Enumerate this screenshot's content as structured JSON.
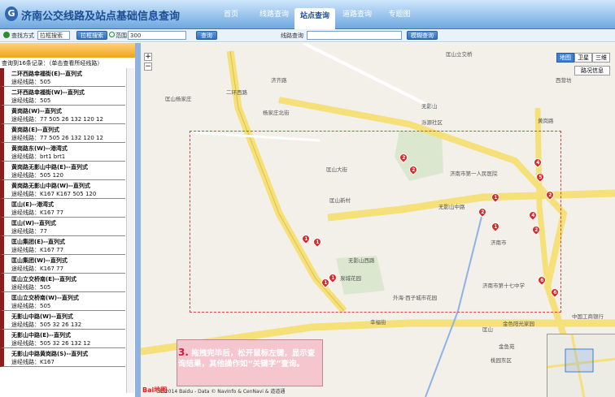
{
  "app": {
    "title": "济南公交线路及站点基础信息查询",
    "logo": "G"
  },
  "nav": {
    "items": [
      {
        "label": "首页",
        "active": false
      },
      {
        "label": "线路查询",
        "active": false
      },
      {
        "label": "站点查询",
        "active": true
      },
      {
        "label": "道路查询",
        "active": false
      },
      {
        "label": "专题图",
        "active": false
      }
    ]
  },
  "toolbar": {
    "mode_label": "查找方式",
    "mode_value": "拉框搜索",
    "box_button": "拉框搜索",
    "range_label": "范围",
    "range_value": "300",
    "query_button": "查询",
    "line_label": "线路查询",
    "line_value": "",
    "fuzzy_button": "模糊查询"
  },
  "panel": {
    "count_text": "查询到16条记录：（单击查看所经线路）",
    "items": [
      {
        "name": "二环西路幸福街(E)--直列式",
        "routes": "途经线路：505"
      },
      {
        "name": "二环西路幸福街(W)--直列式",
        "routes": "途经线路：505"
      },
      {
        "name": "黄岗路(W)--直列式",
        "routes": "途经线路：77 505 26 132 120 12"
      },
      {
        "name": "黄岗路(E)--直列式",
        "routes": "途经线路：77 505 26 132 120 12"
      },
      {
        "name": "黄岗路东(W)--港湾式",
        "routes": "途经线路：brt1 brt1"
      },
      {
        "name": "黄岗路无影山中路(E)--直列式",
        "routes": "途经线路：505 120"
      },
      {
        "name": "黄岗路无影山中路(W)--直列式",
        "routes": "途经线路：K167 K167 505 120"
      },
      {
        "name": "匡山(E)--港湾式",
        "routes": "途经线路：K167 77"
      },
      {
        "name": "匡山(W)--直列式",
        "routes": "途经线路：77"
      },
      {
        "name": "匡山集团(E)--直列式",
        "routes": "途经线路：K167 77"
      },
      {
        "name": "匡山集团(W)--直列式",
        "routes": "途经线路：K167 77"
      },
      {
        "name": "匡山立交桥南(E)--直列式",
        "routes": "途经线路：505"
      },
      {
        "name": "匡山立交桥南(W)--直列式",
        "routes": "途经线路：505"
      },
      {
        "name": "无影山中路(W)--直列式",
        "routes": "途经线路：505 32 26 132"
      },
      {
        "name": "无影山中路(E)--直列式",
        "routes": "途经线路：505 32 26 132 12"
      },
      {
        "name": "无影山中路黄岗路(S)--直列式",
        "routes": "途经线路：K167"
      }
    ]
  },
  "map": {
    "type_buttons": [
      "地图",
      "卫星",
      "三维"
    ],
    "traffic_label": "路况信息",
    "labels": [
      "匡山杨家庄",
      "匡山大街",
      "匡山新村",
      "泉城花园",
      "黄岗路",
      "无影山中路",
      "匡山",
      "幸福街",
      "外海·西子城市花园",
      "匡山立交桥",
      "济南市",
      "济齐路",
      "杨家庄北街",
      "中国工商银行",
      "金鱼苑",
      "金色阳光家园",
      "桃园东区",
      "西营坊",
      "无影山",
      "二环西路",
      "济南市第十七中学",
      "泺源社区",
      "济南市第一人民医院",
      "无影山西路"
    ],
    "markers": [
      "2",
      "2",
      "4",
      "5",
      "1",
      "2",
      "2",
      "4",
      "1",
      "2",
      "1",
      "1",
      "1",
      "1",
      "6",
      "6"
    ],
    "copyright": "© 2014 Baidu - Data © NavInfo & CenNavi & 道道通",
    "baidu_logo": "Bai地图"
  },
  "callout": {
    "step": "3.",
    "text": "拖拽完毕后，松开鼠标左键，显示查询结果，其他操作如“关键字”查询。"
  }
}
